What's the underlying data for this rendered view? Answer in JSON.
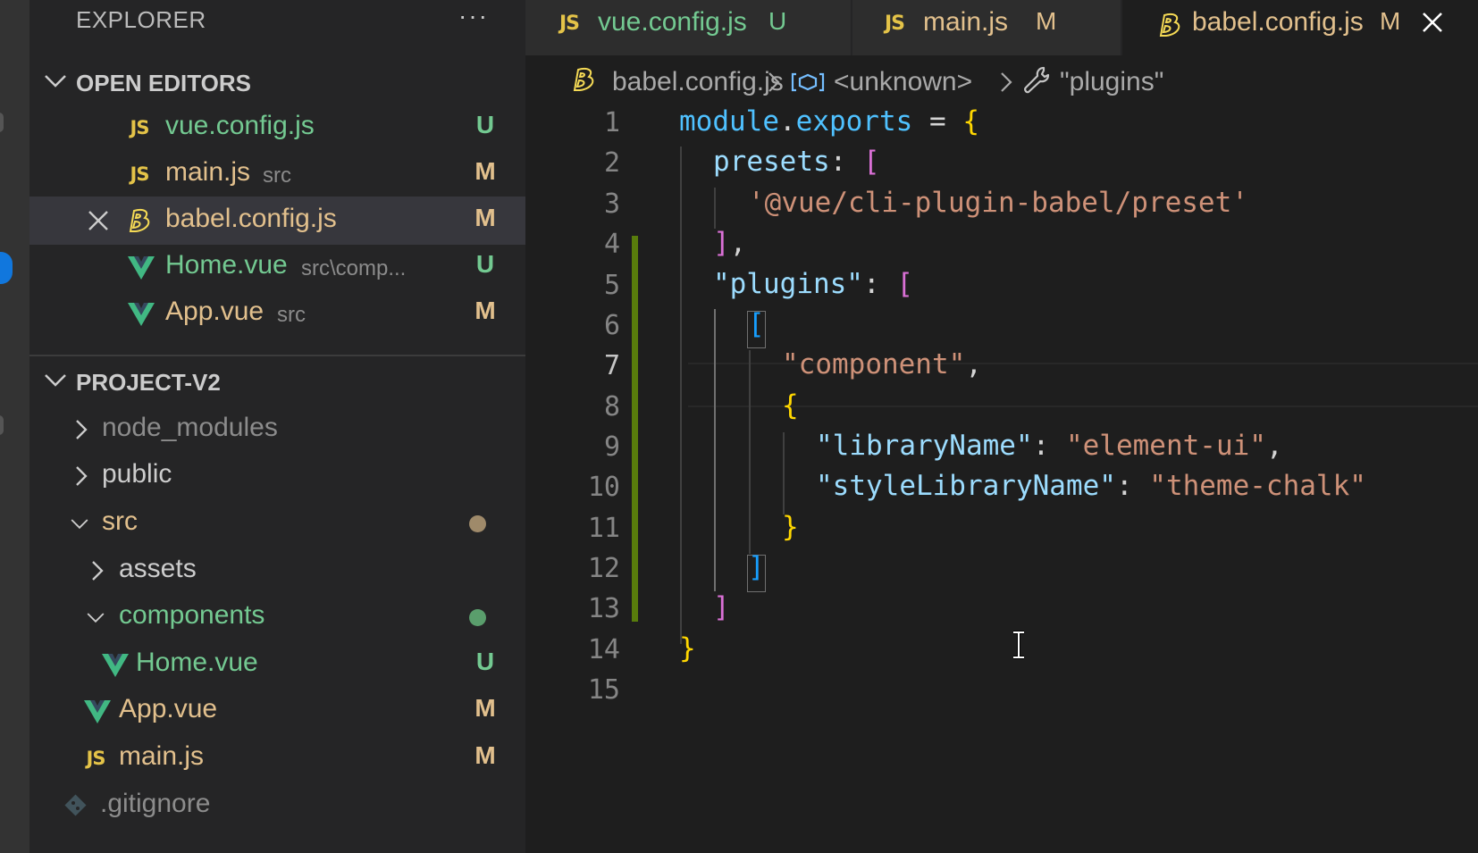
{
  "sidebar": {
    "title": "EXPLORER",
    "more": "···",
    "open_editors": {
      "label": "OPEN EDITORS",
      "items": [
        {
          "icon": "JS",
          "name": "vue.config.js",
          "desc": "",
          "badge": "U"
        },
        {
          "icon": "JS",
          "name": "main.js",
          "desc": "src",
          "badge": "M"
        },
        {
          "icon": "babel",
          "name": "babel.config.js",
          "desc": "",
          "badge": "M"
        },
        {
          "icon": "vue",
          "name": "Home.vue",
          "desc": "src\\comp...",
          "badge": "U"
        },
        {
          "icon": "vue",
          "name": "App.vue",
          "desc": "src",
          "badge": "M"
        }
      ]
    },
    "project": {
      "label": "PROJECT-V2",
      "items": [
        {
          "name": "node_modules",
          "badge": ""
        },
        {
          "name": "public",
          "badge": ""
        },
        {
          "name": "src",
          "badge": ""
        },
        {
          "name": "assets",
          "badge": ""
        },
        {
          "name": "components",
          "badge": ""
        },
        {
          "name": "Home.vue",
          "badge": "U"
        },
        {
          "name": "App.vue",
          "badge": "M"
        },
        {
          "name": "main.js",
          "badge": "M"
        },
        {
          "name": ".gitignore",
          "badge": ""
        }
      ]
    }
  },
  "tabs": [
    {
      "icon": "JS",
      "name": "vue.config.js",
      "badge": "U"
    },
    {
      "icon": "JS",
      "name": "main.js",
      "badge": "M"
    },
    {
      "icon": "babel",
      "name": "babel.config.js",
      "badge": "M"
    }
  ],
  "breadcrumb": {
    "file": "babel.config.js",
    "symbol": "<unknown>",
    "prop": "\"plugins\""
  },
  "editor": {
    "line_numbers": [
      "1",
      "2",
      "3",
      "4",
      "5",
      "6",
      "7",
      "8",
      "9",
      "10",
      "11",
      "12",
      "13",
      "14",
      "15"
    ],
    "lines": {
      "l1": {
        "a": "module",
        "b": ".",
        "c": "exports",
        "d": " = ",
        "e": "{"
      },
      "l2": {
        "a": "presets",
        "b": ": ",
        "c": "["
      },
      "l3": {
        "a": "'@vue/cli-plugin-babel/preset'"
      },
      "l4": {
        "a": "]",
        "b": ","
      },
      "l5": {
        "a": "\"plugins\"",
        "b": ": ",
        "c": "["
      },
      "l6": {
        "a": "["
      },
      "l7": {
        "a": "\"component\"",
        "b": ","
      },
      "l8": {
        "a": "{"
      },
      "l9": {
        "a": "\"libraryName\"",
        "b": ": ",
        "c": "\"element-ui\"",
        "d": ","
      },
      "l10": {
        "a": "\"styleLibraryName\"",
        "b": ": ",
        "c": "\"theme-chalk\""
      },
      "l11": {
        "a": "}"
      },
      "l12": {
        "a": "]"
      },
      "l13": {
        "a": "]"
      },
      "l14": {
        "a": "}"
      }
    }
  },
  "colors": {
    "untracked": "#73c991",
    "modified": "#e2c08d",
    "js_icon": "#e4c348",
    "vue_icon": "#41b883",
    "git_change_bar": "#587c0c"
  }
}
